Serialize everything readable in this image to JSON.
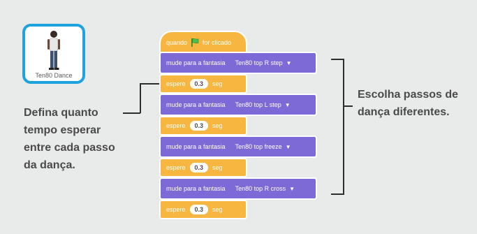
{
  "sprite": {
    "name": "Ten80 Dance"
  },
  "callouts": {
    "left": "Defina quanto tempo esperar entre cada passo da dança.",
    "right_line1": "Escolha passos de",
    "right_line2": "dança diferentes."
  },
  "blocks": {
    "hat": {
      "label_before": "quando",
      "label_after": "for clicado",
      "icon": "green-flag-icon"
    },
    "steps": [
      {
        "motion_label": "mude para a fantasia",
        "costume": "Ten80 top R step",
        "wait_label": "espere",
        "seconds": "0.3",
        "unit": "seg"
      },
      {
        "motion_label": "mude para a fantasia",
        "costume": "Ten80 top L step",
        "wait_label": "espere",
        "seconds": "0.3",
        "unit": "seg"
      },
      {
        "motion_label": "mude para a fantasia",
        "costume": "Ten80 top freeze",
        "wait_label": "espere",
        "seconds": "0.3",
        "unit": "seg"
      },
      {
        "motion_label": "mude para a fantasia",
        "costume": "Ten80 top R cross",
        "wait_label": "espere",
        "seconds": "0.3",
        "unit": "seg"
      }
    ]
  },
  "colors": {
    "events": "#f6b63f",
    "looks": "#7d6ad6",
    "sprite_border": "#1fa3de",
    "flag": "#4cbf4c"
  }
}
